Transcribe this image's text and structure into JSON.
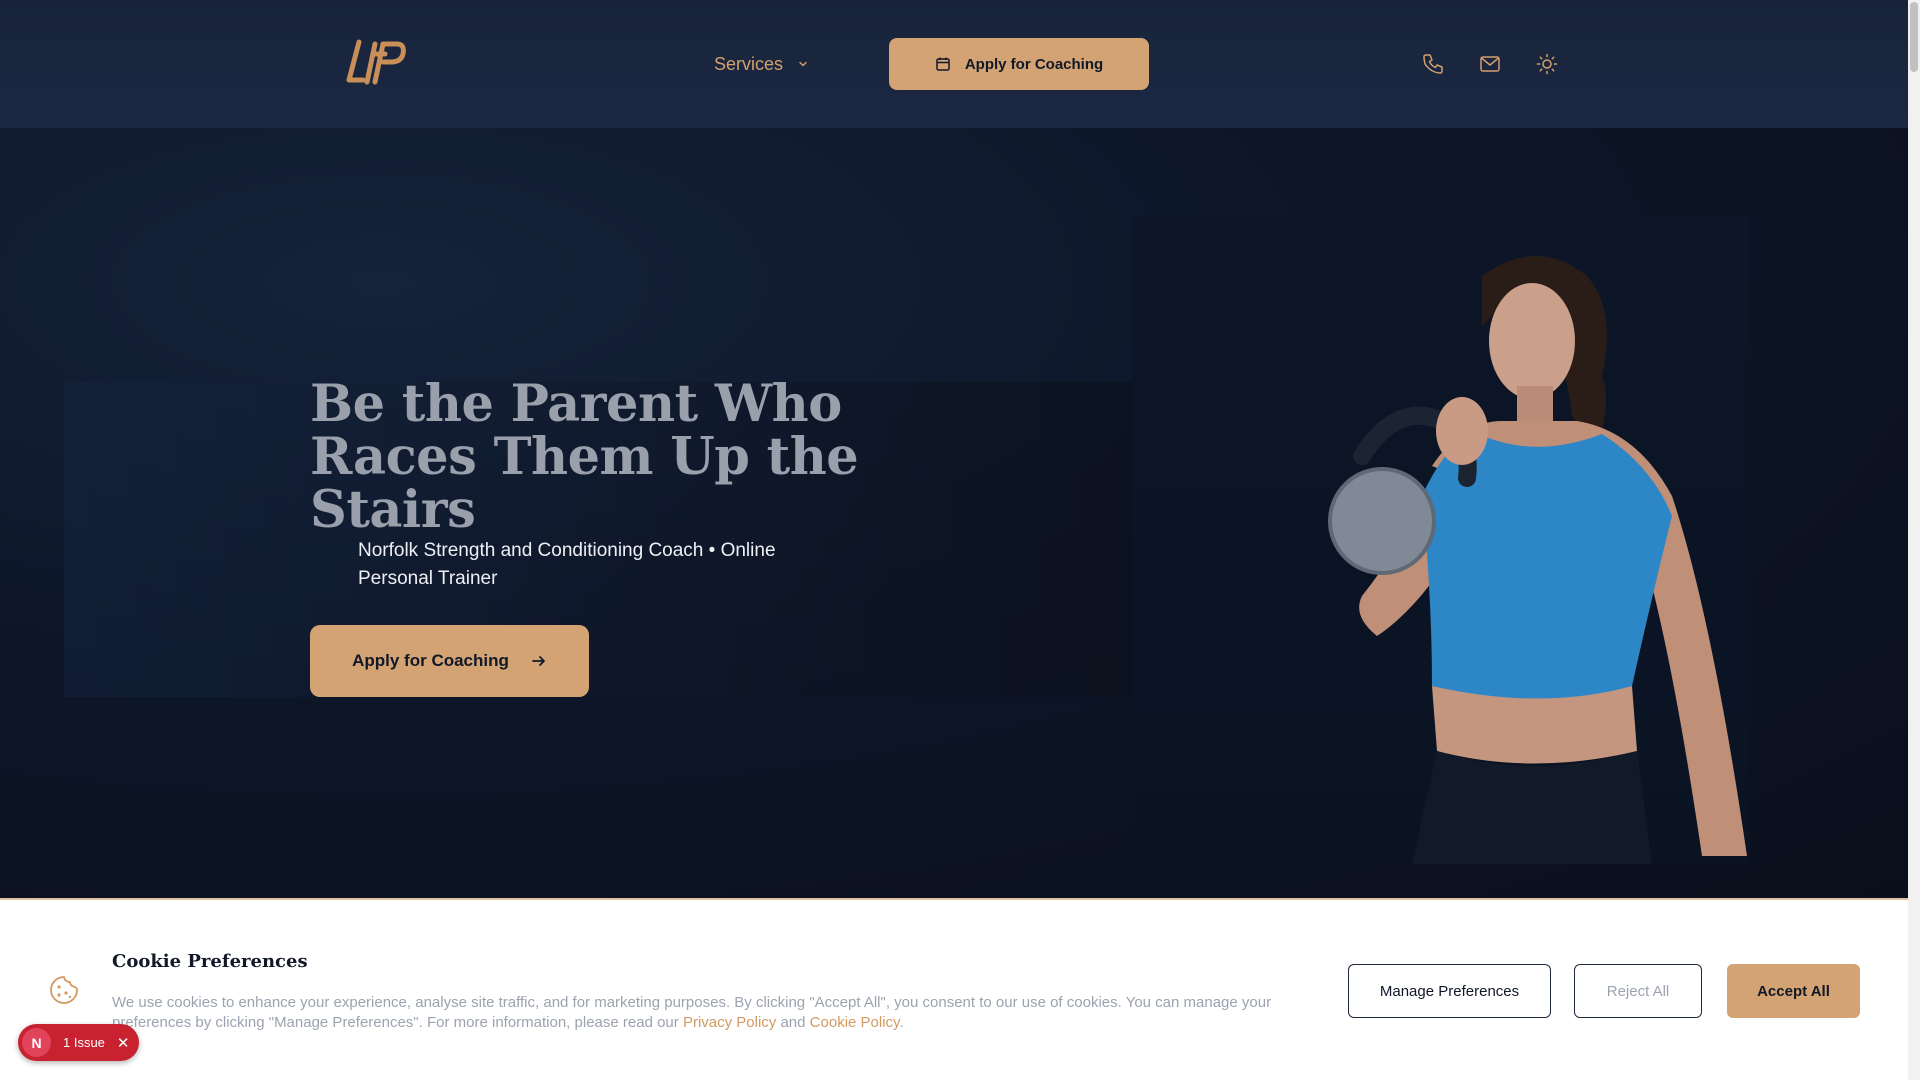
{
  "header": {
    "logo_text": "LFP",
    "nav_services": "Services",
    "cta_label": "Apply for Coaching",
    "icons": [
      "phone-icon",
      "mail-icon",
      "sun-icon"
    ]
  },
  "hero": {
    "title": "Be the Parent Who Races Them Up the Stairs",
    "subtitle": "Norfolk Strength and Conditioning Coach • Online Personal Trainer",
    "cta_label": "Apply for Coaching",
    "image": "woman-with-kettlebell-photo"
  },
  "cookie": {
    "title": "Cookie Preferences",
    "text_before": "We use cookies to enhance your experience, analyse site traffic, and for marketing purposes. By clicking \"Accept All\", you consent to our use of cookies. You can manage your preferences by clicking \"Manage Preferences\". For more information, please read our ",
    "privacy_link": "Privacy Policy",
    "and": " and ",
    "cookie_link": "Cookie Policy",
    "period": ".",
    "manage_label": "Manage Preferences",
    "reject_label": "Reject All",
    "accept_label": "Accept All"
  },
  "issue_badge": {
    "initial": "N",
    "label": "1 Issue",
    "close": "✕"
  },
  "colors": {
    "accent": "#d4a373",
    "header_bg": "#1a2540",
    "hero_bg": "#0d1628",
    "badge_red": "#c8212f"
  }
}
